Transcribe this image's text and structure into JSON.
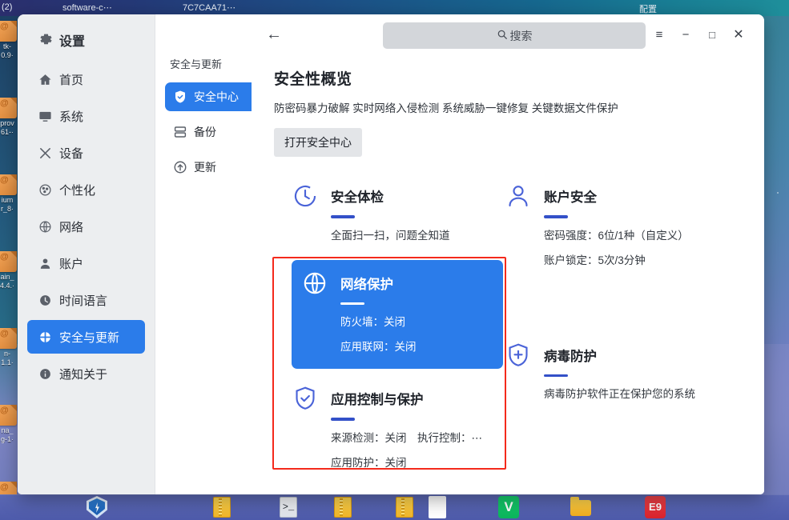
{
  "desktop": {
    "top_strip": {
      "left_badge": "(2)",
      "item_a": "software-c⋯",
      "item_b": "7C7CAA71⋯",
      "item_right": "配置"
    },
    "icons": [
      {
        "label_line1": "tk-",
        "label_line2": "0.9·"
      },
      {
        "label_line1": "prov",
        "label_line2": "61-·"
      },
      {
        "label_line1": "ium",
        "label_line2": "r_8·"
      },
      {
        "label_line1": "ain_",
        "label_line2": "4.4.·"
      },
      {
        "label_line1": "n-",
        "label_line2": "1.1·"
      },
      {
        "label_line1": "na_",
        "label_line2": "g-1·"
      }
    ],
    "taskbar_items": [
      {
        "name": "security-shield",
        "glyph": ""
      },
      {
        "name": "archive-1",
        "glyph": ""
      },
      {
        "name": "archive-2",
        "glyph": ""
      },
      {
        "name": "terminal",
        "glyph": ">_"
      },
      {
        "name": "archive-3",
        "glyph": ""
      },
      {
        "name": "document-app",
        "glyph": ""
      },
      {
        "name": "green-app",
        "glyph": "V"
      },
      {
        "name": "file-manager",
        "glyph": ""
      },
      {
        "name": "red-app",
        "glyph": "E9"
      }
    ]
  },
  "window": {
    "titlebar": {
      "back_label": "←",
      "menu_label": "≡",
      "minimize_label": "−",
      "maximize_label": "□",
      "close_label": "✕"
    },
    "search": {
      "icon": "search-icon",
      "placeholder": "搜索",
      "value": ""
    }
  },
  "sidebar": {
    "app_title": "设置",
    "items": [
      {
        "label": "首页",
        "icon": "home-icon",
        "selected": false
      },
      {
        "label": "系统",
        "icon": "monitor-icon",
        "selected": false
      },
      {
        "label": "设备",
        "icon": "devices-icon",
        "selected": false
      },
      {
        "label": "个性化",
        "icon": "palette-icon",
        "selected": false
      },
      {
        "label": "网络",
        "icon": "globe-icon",
        "selected": false
      },
      {
        "label": "账户",
        "icon": "user-icon",
        "selected": false
      },
      {
        "label": "时间语言",
        "icon": "clock-icon",
        "selected": false
      },
      {
        "label": "安全与更新",
        "icon": "security-icon",
        "selected": true
      },
      {
        "label": "通知关于",
        "icon": "info-icon",
        "selected": false
      }
    ]
  },
  "subnav": {
    "group_label": "安全与更新",
    "items": [
      {
        "label": "安全中心",
        "icon": "shield-check-icon",
        "selected": true
      },
      {
        "label": "备份",
        "icon": "backup-icon",
        "selected": false
      },
      {
        "label": "更新",
        "icon": "update-arrow-icon",
        "selected": false
      }
    ]
  },
  "main": {
    "page_title": "安全性概览",
    "subtitle": "防密码暴力破解 实时网络入侵检测 系统威胁一键修复 关键数据文件保护",
    "open_button": "打开安全中心",
    "cards": {
      "security_check": {
        "title": "安全体检",
        "icon": "scan-clock-icon",
        "lines": [
          "全面扫一扫，问题全知道"
        ]
      },
      "account_security": {
        "title": "账户安全",
        "icon": "user-outline-icon",
        "lines": [
          "密码强度：6位/1种（自定义）",
          "账户锁定：5次/3分钟"
        ]
      },
      "network_protection": {
        "title": "网络保护",
        "icon": "globe-outline-icon",
        "highlighted": true,
        "lines": [
          "防火墙：关闭",
          "应用联网：关闭"
        ]
      },
      "virus_protection": {
        "title": "病毒防护",
        "icon": "shield-plus-icon",
        "lines": [
          "病毒防护软件正在保护您的系统"
        ]
      },
      "app_control": {
        "title": "应用控制与保护",
        "icon": "shield-check-outline-icon",
        "lines": [
          "来源检测：关闭　执行控制：⋯",
          "应用防护：关闭"
        ]
      }
    }
  },
  "annotation": {
    "highlight_box_color": "#f42a1c"
  },
  "colors": {
    "accent_blue": "#2b7cea",
    "card_icon_blue": "#4a63d8",
    "rule_blue": "#3350c8",
    "sidebar_bg": "#eceef0",
    "search_bg": "#d3d6da",
    "button_bg": "#e3e5e8"
  }
}
